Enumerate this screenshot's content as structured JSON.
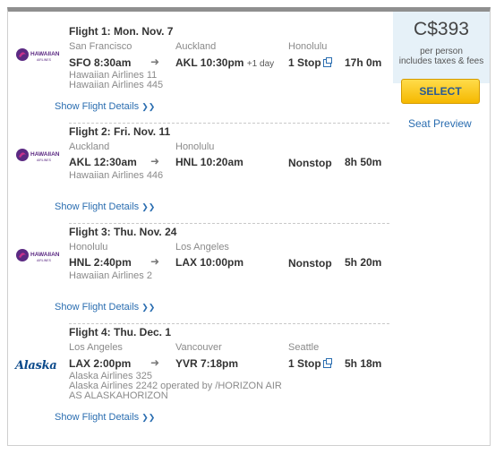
{
  "price": {
    "amount": "C$393",
    "note_line1": "per person",
    "note_line2": "includes taxes & fees"
  },
  "select_label": "SELECT",
  "seat_preview_label": "Seat Preview",
  "details_label": "Show Flight Details",
  "flights": [
    {
      "title": "Flight 1:  Mon. Nov. 7",
      "origin_city": "San Francisco",
      "dest_city": "Auckland",
      "stop_city": "Honolulu",
      "depart": "SFO  8:30am",
      "arrive": "AKL  10:30pm",
      "plus_day": "+1 day",
      "stops": "1 Stop",
      "duration": "17h 0m",
      "airlines": [
        "Hawaiian Airlines 11",
        "Hawaiian Airlines 445"
      ],
      "logo": "HAWAIIAN",
      "logo_sub": "AIRLINES"
    },
    {
      "title": "Flight 2:  Fri. Nov. 11",
      "origin_city": "Auckland",
      "dest_city": "Honolulu",
      "depart": "AKL  12:30am",
      "arrive": "HNL  10:20am",
      "stops": "Nonstop",
      "duration": "8h 50m",
      "airlines": [
        "Hawaiian Airlines 446"
      ],
      "logo": "HAWAIIAN",
      "logo_sub": "AIRLINES"
    },
    {
      "title": "Flight 3:  Thu. Nov. 24",
      "origin_city": "Honolulu",
      "dest_city": "Los Angeles",
      "depart": "HNL  2:40pm",
      "arrive": "LAX  10:00pm",
      "stops": "Nonstop",
      "duration": "5h 20m",
      "airlines": [
        "Hawaiian Airlines 2"
      ],
      "logo": "HAWAIIAN",
      "logo_sub": "AIRLINES"
    },
    {
      "title": "Flight 4:  Thu. Dec. 1",
      "origin_city": "Los Angeles",
      "dest_city": "Vancouver",
      "stop_city": "Seattle",
      "depart": "LAX  2:00pm",
      "arrive": "YVR  7:18pm",
      "stops": "1 Stop",
      "duration": "5h 18m",
      "airlines": [
        "Alaska Airlines 325",
        "Alaska Airlines 2242 operated by /HORIZON AIR",
        "AS ALASKAHORIZON"
      ],
      "logo": "Alaska"
    }
  ],
  "colors": {
    "link": "#2a6db0",
    "select_button": "#f5b800",
    "price_panel": "#e6f1f8",
    "hawaiian_purple": "#5b2a83",
    "hawaiian_pink": "#c8338c",
    "alaska_blue": "#0b4a8b"
  }
}
